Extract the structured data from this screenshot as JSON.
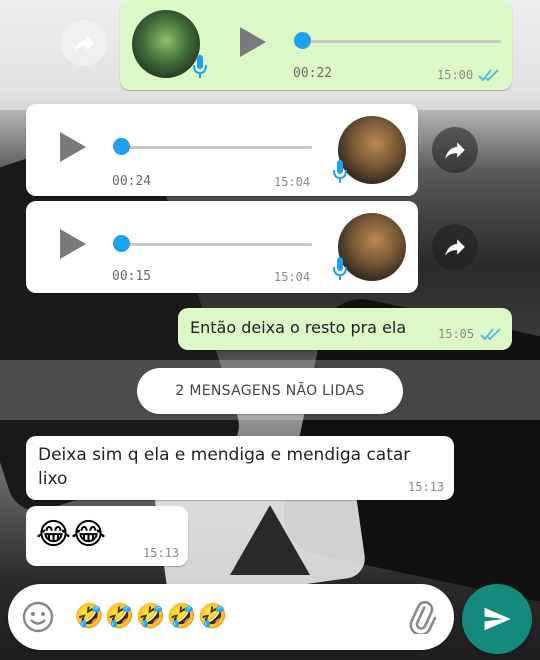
{
  "messages": [
    {
      "type": "voice",
      "direction": "outgoing",
      "duration": "00:22",
      "time": "15:00",
      "read": true
    },
    {
      "type": "voice",
      "direction": "incoming",
      "duration": "00:24",
      "time": "15:04"
    },
    {
      "type": "voice",
      "direction": "incoming",
      "duration": "00:15",
      "time": "15:04"
    },
    {
      "type": "text",
      "direction": "outgoing",
      "text": "Então deixa o resto pra ela",
      "time": "15:05",
      "read": true
    },
    {
      "type": "text",
      "direction": "incoming",
      "text": "Deixa sim q ela e mendiga e mendiga catar lixo",
      "time": "15:13"
    },
    {
      "type": "text",
      "direction": "incoming",
      "text": "😂😂",
      "time": "15:13"
    }
  ],
  "unread_banner": "2 MENSAGENS NÃO LIDAS",
  "composer": {
    "value": "🤣🤣🤣🤣🤣",
    "icons": [
      "emoji-icon",
      "attach-icon",
      "send-icon"
    ]
  },
  "colors": {
    "outgoing_bubble": "#dcf8c6",
    "incoming_bubble": "#ffffff",
    "voice_progress": "#1ea0f0",
    "send_button": "#148a7d",
    "read_ticks": "#4fb6ec"
  }
}
